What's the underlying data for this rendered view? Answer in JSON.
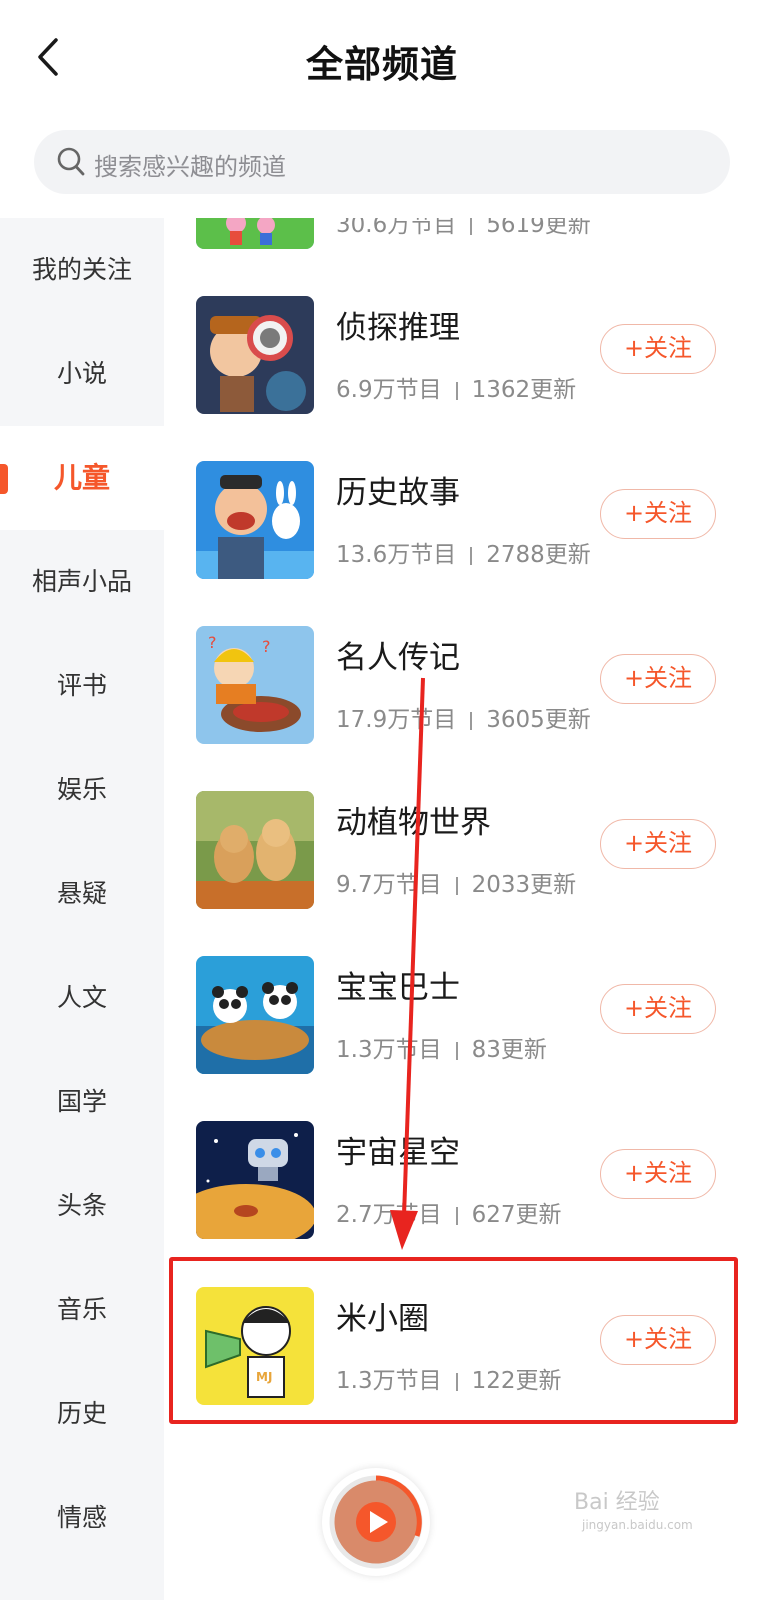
{
  "header": {
    "title": "全部频道",
    "back_icon": "chevron-left-icon"
  },
  "search": {
    "placeholder": "搜索感兴趣的频道",
    "icon": "search-icon"
  },
  "sidebar": {
    "active_color": "#f5572b",
    "items": [
      {
        "label": "我的关注"
      },
      {
        "label": "小说"
      },
      {
        "label": "儿童",
        "active": true
      },
      {
        "label": "相声小品"
      },
      {
        "label": "评书"
      },
      {
        "label": "娱乐"
      },
      {
        "label": "悬疑"
      },
      {
        "label": "人文"
      },
      {
        "label": "国学"
      },
      {
        "label": "头条"
      },
      {
        "label": "音乐"
      },
      {
        "label": "历史"
      },
      {
        "label": "情感"
      }
    ]
  },
  "channels": [
    {
      "name": "",
      "programs": "30.6万节目",
      "updates": "5619更新"
    },
    {
      "name": "侦探推理",
      "programs": "6.9万节目",
      "updates": "1362更新",
      "follow": "+关注"
    },
    {
      "name": "历史故事",
      "programs": "13.6万节目",
      "updates": "2788更新",
      "follow": "+关注"
    },
    {
      "name": "名人传记",
      "programs": "17.9万节目",
      "updates": "3605更新",
      "follow": "+关注"
    },
    {
      "name": "动植物世界",
      "programs": "9.7万节目",
      "updates": "2033更新",
      "follow": "+关注"
    },
    {
      "name": "宝宝巴士",
      "programs": "1.3万节目",
      "updates": "83更新",
      "follow": "+关注"
    },
    {
      "name": "宇宙星空",
      "programs": "2.7万节目",
      "updates": "627更新",
      "follow": "+关注"
    },
    {
      "name": "米小圈",
      "programs": "1.3万节目",
      "updates": "122更新",
      "follow": "+关注"
    }
  ],
  "annotation": {
    "highlight_color": "#e8241f"
  },
  "watermark": {
    "text": "Bai 经验",
    "sub": "jingyan.baidu.com"
  }
}
